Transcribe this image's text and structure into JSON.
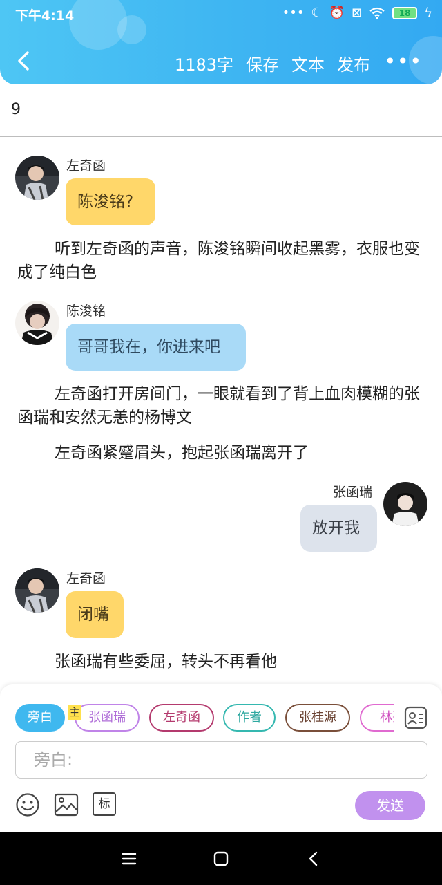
{
  "status": {
    "time": "下午4:14",
    "battery": "18",
    "icons": [
      "dots-icon",
      "moon-icon",
      "alarm-icon",
      "sim-off-icon",
      "wifi-icon",
      "battery-icon",
      "charging-icon"
    ]
  },
  "toolbar": {
    "word_count": "1183字",
    "save_label": "保存",
    "text_label": "文本",
    "publish_label": "发布",
    "more_label": "•••"
  },
  "chapter": "9",
  "messages": [
    {
      "type": "dialog",
      "speaker": "左奇函",
      "text": "陈浚铭?"
    },
    {
      "type": "narration",
      "text": "听到左奇函的声音，陈浚铭瞬间收起黑雾，衣服也变成了纯白色"
    },
    {
      "type": "dialog",
      "speaker": "陈浚铭",
      "text": "哥哥我在，你进来吧"
    },
    {
      "type": "narration",
      "text": "左奇函打开房间门，一眼就看到了背上血肉模糊的张函瑞和安然无恙的杨博文"
    },
    {
      "type": "narration",
      "text": "左奇函紧蹙眉头，抱起张函瑞离开了"
    },
    {
      "type": "dialog",
      "speaker": "张函瑞",
      "text": "放开我"
    },
    {
      "type": "dialog",
      "speaker": "左奇函",
      "text": "闭嘴"
    },
    {
      "type": "narration",
      "text": "张函瑞有些委屈，转头不再看他"
    }
  ],
  "chips": [
    {
      "label": "旁白",
      "selected": true
    },
    {
      "label": "张函瑞",
      "main_tag": "主"
    },
    {
      "label": "左奇函"
    },
    {
      "label": "作者"
    },
    {
      "label": "张桂源"
    },
    {
      "label": "林熹"
    }
  ],
  "input": {
    "placeholder": "旁白:"
  },
  "send_label": "发送",
  "tools": {
    "tag_label": "标"
  },
  "colors": {
    "header": "#3fb6f2",
    "bubble_yellow": "#ffd76a",
    "bubble_blue": "#a9daf7",
    "bubble_gray": "#dde3ec",
    "chip_selected": "#3fb8ef",
    "chip_zhang": "#c084e8",
    "chip_zuo": "#b43a6e",
    "chip_author": "#35b8b0",
    "chip_gui": "#7a4f3a",
    "chip_lin": "#e06ad0",
    "send": "#c191ee"
  }
}
